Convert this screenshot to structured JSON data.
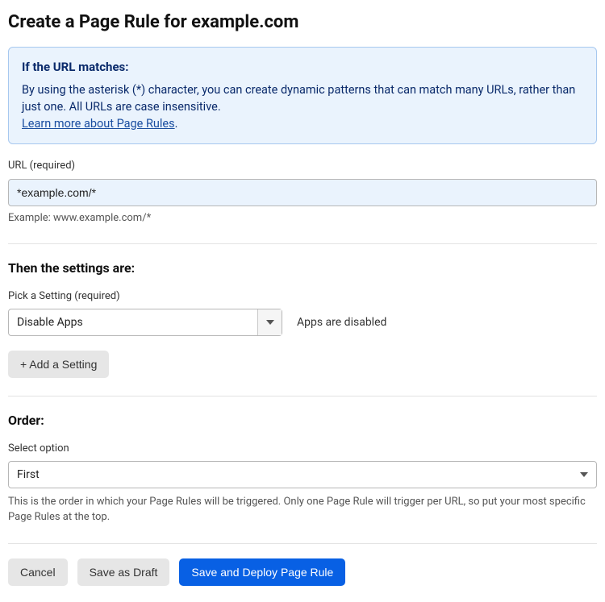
{
  "title": "Create a Page Rule for example.com",
  "info": {
    "heading": "If the URL matches:",
    "body": "By using the asterisk (*) character, you can create dynamic patterns that can match many URLs, rather than just one. All URLs are case insensitive.",
    "link_label": "Learn more about Page Rules",
    "link_suffix": "."
  },
  "url_field": {
    "label": "URL (required)",
    "value": "*example.com/*",
    "example": "Example: www.example.com/*"
  },
  "settings": {
    "heading": "Then the settings are:",
    "picker_label": "Pick a Setting (required)",
    "selected": "Disable Apps",
    "description": "Apps are disabled",
    "add_button": "+ Add a Setting"
  },
  "order": {
    "heading": "Order:",
    "label": "Select option",
    "selected": "First",
    "description": "This is the order in which your Page Rules will be triggered. Only one Page Rule will trigger per URL, so put your most specific Page Rules at the top."
  },
  "footer": {
    "cancel": "Cancel",
    "save_draft": "Save as Draft",
    "save_deploy": "Save and Deploy Page Rule"
  }
}
